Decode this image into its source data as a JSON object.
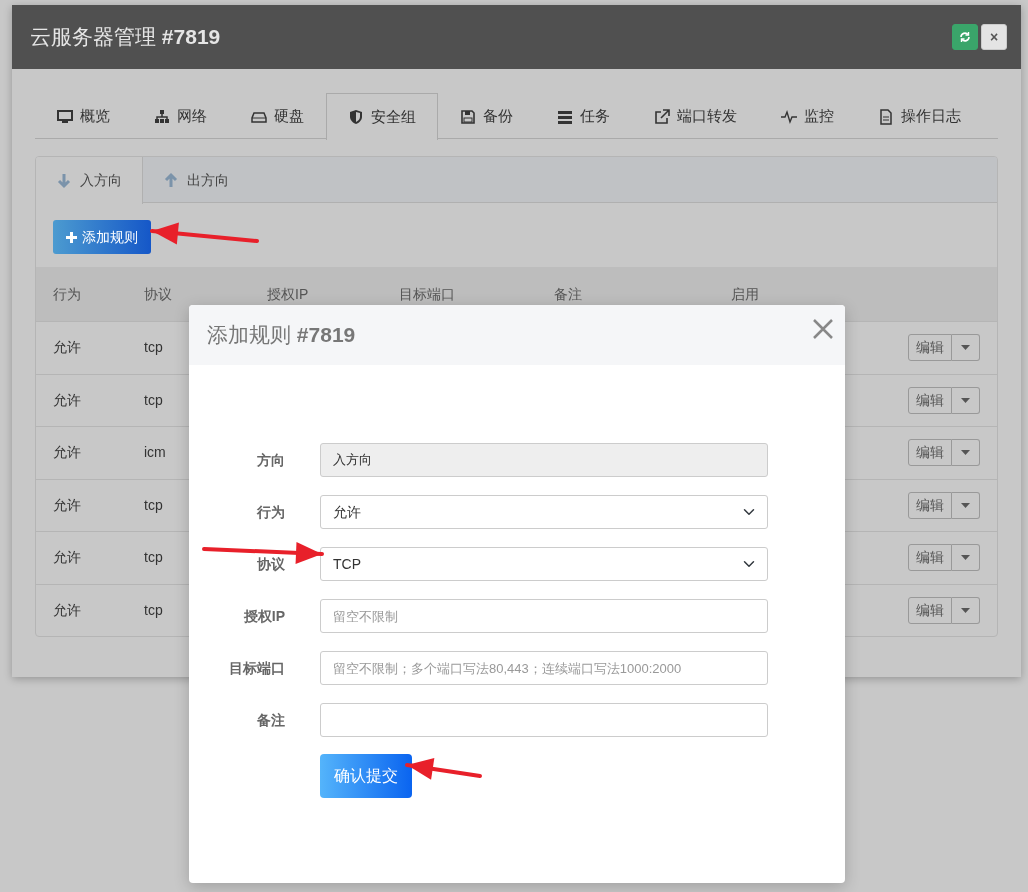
{
  "window": {
    "title": "云服务器管理 **#7819**",
    "close": "×"
  },
  "tabs": [
    {
      "label": "概览",
      "selected": false
    },
    {
      "label": "网络",
      "selected": false
    },
    {
      "label": "硬盘",
      "selected": false
    },
    {
      "label": "安全组",
      "selected": true
    },
    {
      "label": "备份",
      "selected": false
    },
    {
      "label": "任务",
      "selected": false
    },
    {
      "label": "端口转发",
      "selected": false
    },
    {
      "label": "监控",
      "selected": false
    },
    {
      "label": "操作日志",
      "selected": false
    }
  ],
  "direction_tabs": [
    {
      "label": "入方向",
      "selected": true
    },
    {
      "label": "出方向",
      "selected": false
    }
  ],
  "add_button": "添加规则",
  "table": {
    "columns": [
      "行为",
      "协议",
      "授权IP",
      "目标端口",
      "备注",
      "启用"
    ],
    "rows": [
      {
        "action": "允许",
        "protocol": "tcp",
        "edit": "编辑"
      },
      {
        "action": "允许",
        "protocol": "tcp",
        "edit": "编辑"
      },
      {
        "action": "允许",
        "protocol": "icm",
        "edit": "编辑"
      },
      {
        "action": "允许",
        "protocol": "tcp",
        "edit": "编辑"
      },
      {
        "action": "允许",
        "protocol": "tcp",
        "edit": "编辑"
      },
      {
        "action": "允许",
        "protocol": "tcp",
        "edit": "编辑"
      }
    ]
  },
  "modal": {
    "title": "添加规则 **#7819**",
    "fields": [
      {
        "label": "方向",
        "kind": "readonly",
        "value": "入方向"
      },
      {
        "label": "行为",
        "kind": "select",
        "value": "允许"
      },
      {
        "label": "协议",
        "kind": "select",
        "value": "TCP"
      },
      {
        "label": "授权IP",
        "kind": "input",
        "placeholder": "留空不限制"
      },
      {
        "label": "目标端口",
        "kind": "input",
        "placeholder": "留空不限制；多个端口写法80,443；连续端口写法1000:2000"
      },
      {
        "label": "备注",
        "kind": "input"
      }
    ],
    "submit": "确认提交"
  }
}
